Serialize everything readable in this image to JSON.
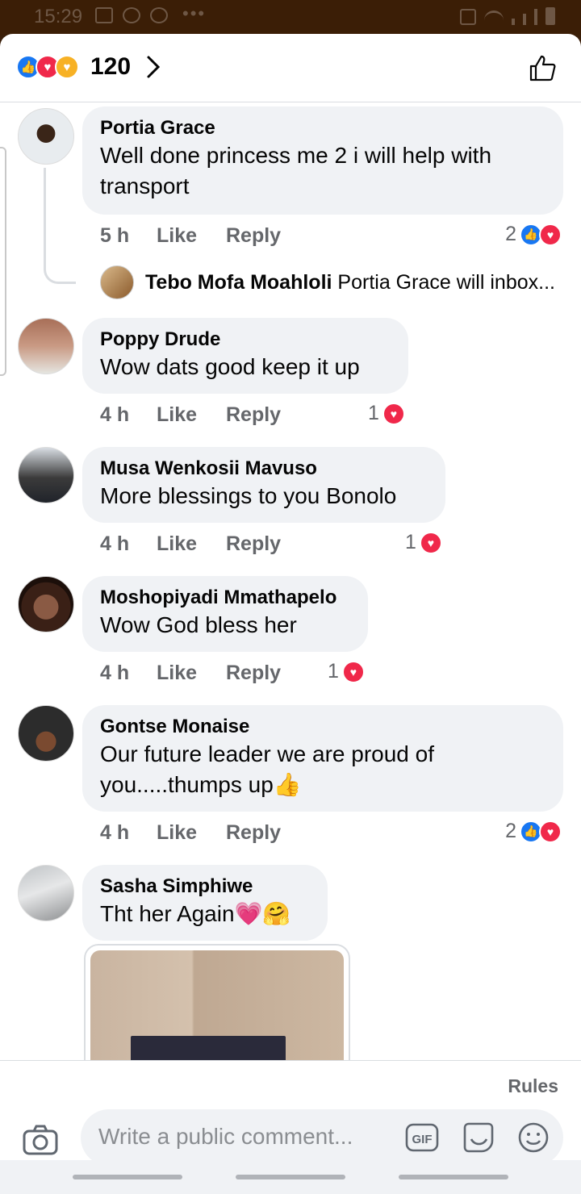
{
  "status_bar": {
    "time": "15:29"
  },
  "header": {
    "reaction_count": "120"
  },
  "comments": [
    {
      "name": "Portia Grace",
      "text": "Well done princess me 2 i will help with transport",
      "time": "5 h",
      "like": "Like",
      "reply": "Reply",
      "reactions": "2"
    },
    {
      "name": "Poppy Drude",
      "text": "Wow dats good keep it up",
      "time": "4 h",
      "like": "Like",
      "reply": "Reply",
      "reactions": "1"
    },
    {
      "name": "Musa Wenkosii Mavuso",
      "text": "More blessings to you Bonolo",
      "time": "4 h",
      "like": "Like",
      "reply": "Reply",
      "reactions": "1"
    },
    {
      "name": "Moshopiyadi Mmathapelo",
      "text": "Wow God bless her",
      "time": "4 h",
      "like": "Like",
      "reply": "Reply",
      "reactions": "1"
    },
    {
      "name": "Gontse Monaise",
      "text": "Our future leader we are proud of you.....thumps up👍",
      "time": "4 h",
      "like": "Like",
      "reply": "Reply",
      "reactions": "2"
    },
    {
      "name": "Sasha Simphiwe",
      "text": "Tht her Again💗🤗"
    }
  ],
  "reply_preview": {
    "name": "Tebo Mofa Moahloli",
    "text": "Portia Grace will inbox..."
  },
  "composer": {
    "rules": "Rules",
    "placeholder": "Write a public comment..."
  }
}
